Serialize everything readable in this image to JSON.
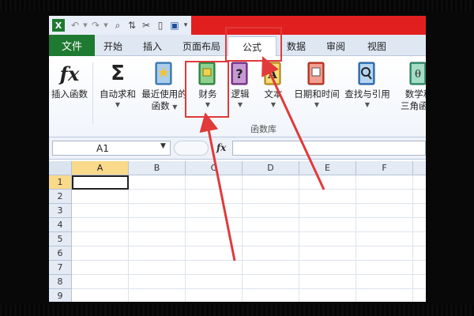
{
  "quick_access": {
    "excel_icon": "excel-logo",
    "undo_icon": "undo-icon",
    "redo_icon": "redo-icon",
    "save_icon": "save-icon"
  },
  "tabs": [
    {
      "id": "file",
      "label": "文件"
    },
    {
      "id": "home",
      "label": "开始"
    },
    {
      "id": "insert",
      "label": "插入"
    },
    {
      "id": "page-layout",
      "label": "页面布局"
    },
    {
      "id": "formulas",
      "label": "公式"
    },
    {
      "id": "data",
      "label": "数据"
    },
    {
      "id": "review",
      "label": "审阅"
    },
    {
      "id": "view",
      "label": "视图"
    }
  ],
  "ribbon": {
    "insert_function": {
      "icon": "fx-icon",
      "label": "插入函数"
    },
    "autosum": {
      "icon": "sigma-icon",
      "label": "自动求和"
    },
    "recent": {
      "icon": "book-star-icon",
      "label1": "最近使用的",
      "label2": "函数"
    },
    "financial": {
      "icon": "book-finance-icon",
      "label": "财务"
    },
    "logical": {
      "icon": "book-question-icon",
      "label": "逻辑"
    },
    "text": {
      "icon": "book-text-icon",
      "label": "文本"
    },
    "datetime": {
      "icon": "book-clock-icon",
      "label": "日期和时间"
    },
    "lookup": {
      "icon": "book-magnifier-icon",
      "label": "查找与引用"
    },
    "math": {
      "icon": "book-theta-icon",
      "label1": "数学和",
      "label2": "三角函数"
    },
    "group_label": "函数库"
  },
  "formula_bar": {
    "name_box": "A1",
    "fx": "fx",
    "value": ""
  },
  "sheet": {
    "columns": [
      "A",
      "B",
      "C",
      "D",
      "E",
      "F"
    ],
    "rows": [
      "1",
      "2",
      "3",
      "4",
      "5",
      "6",
      "7",
      "8",
      "9"
    ],
    "active_cell": "A1"
  },
  "colors": {
    "file_tab": "#1f7a31",
    "annotation": "#e03a3a",
    "title_bar": "#e21f1f"
  }
}
